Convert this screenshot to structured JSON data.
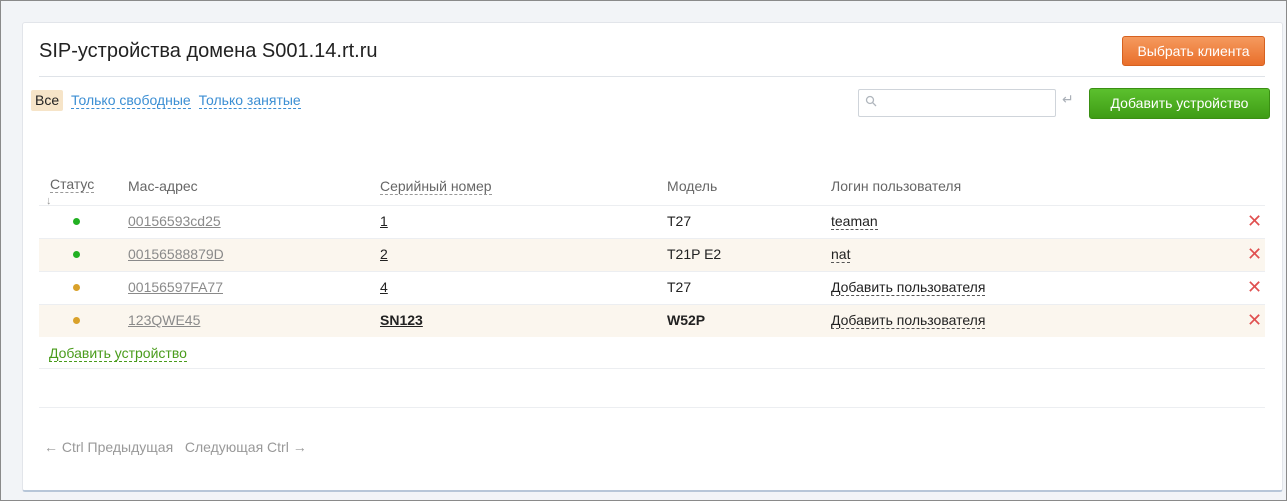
{
  "header": {
    "title": "SIP-устройства домена S001.14.rt.ru",
    "select_client": "Выбрать клиента"
  },
  "filters": {
    "all": "Все",
    "free_only": "Только свободные",
    "busy_only": "Только занятые"
  },
  "search": {
    "placeholder": "",
    "value": ""
  },
  "toolbar": {
    "add_device": "Добавить устройство",
    "enter_hint": "↵"
  },
  "columns": {
    "status": "Статус",
    "sort_indicator": "↓",
    "mac": "Mac-адрес",
    "serial": "Серийный номер",
    "model": "Модель",
    "login": "Логин пользователя"
  },
  "rows": [
    {
      "status": "online",
      "mac": "00156593cd25",
      "serial": "1",
      "model": "T27",
      "login": "teaman"
    },
    {
      "status": "online",
      "mac": "00156588879D",
      "serial": "2",
      "model": "T21P E2",
      "login": "nat"
    },
    {
      "status": "offline",
      "mac": "00156597FA77",
      "serial": "4",
      "model": "T27",
      "login": "Добавить пользователя"
    },
    {
      "status": "offline",
      "mac": "123QWE45",
      "serial": "SN123",
      "model": "W52P",
      "login": "Добавить пользователя"
    }
  ],
  "status_colors": {
    "online": "#22b022",
    "offline": "#d9a12a"
  },
  "delete_glyph": "✕",
  "add_device_link": "Добавить устройство",
  "pager": {
    "prev": "← Ctrl Предыдущая",
    "next": "Следующая Ctrl →"
  }
}
